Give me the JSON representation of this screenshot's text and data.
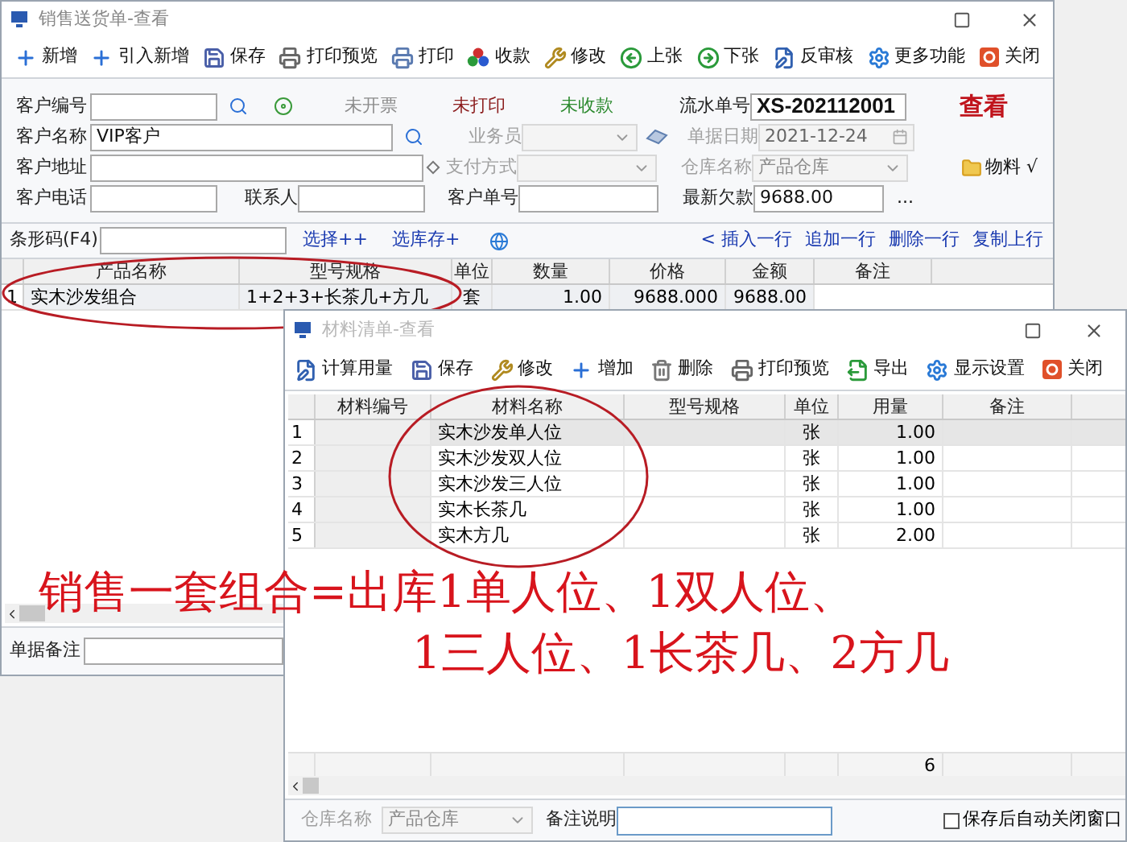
{
  "main_window": {
    "title": "销售送货单-查看",
    "toolbar": [
      {
        "label": "新增"
      },
      {
        "label": "引入新增"
      },
      {
        "label": "保存"
      },
      {
        "label": "打印预览"
      },
      {
        "label": "打印"
      },
      {
        "label": "收款"
      },
      {
        "label": "修改"
      },
      {
        "label": "上张"
      },
      {
        "label": "下张"
      },
      {
        "label": "反审核"
      },
      {
        "label": "更多功能"
      },
      {
        "label": "关闭"
      }
    ],
    "customer_code": {
      "label": "客户编号"
    },
    "status": [
      {
        "text": "未开票",
        "color": "#8c8c8c"
      },
      {
        "text": "未打印",
        "color": "#8b1c1c"
      },
      {
        "text": "未收款",
        "color": "#2e8b30"
      }
    ],
    "serial_no": {
      "label": "流水单号",
      "value": "XS-202112001"
    },
    "view_mode": "查看",
    "customer_name": {
      "label": "客户名称",
      "value": "VIP客户"
    },
    "salesperson": {
      "label": "业务员",
      "disabled": true
    },
    "doc_date": {
      "label": "单据日期",
      "value": "2021-12-24",
      "disabled": true
    },
    "customer_address": {
      "label": "客户地址"
    },
    "payment_method": {
      "label": "支付方式",
      "disabled": true
    },
    "warehouse": {
      "label": "仓库名称",
      "value": "产品仓库",
      "disabled": true
    },
    "materials_link": "物料 √",
    "customer_phone": {
      "label": "客户电话"
    },
    "contact": {
      "label": "联系人"
    },
    "customer_order_no": {
      "label": "客户单号"
    },
    "latest_debt": {
      "label": "最新欠款",
      "value": "9688.00"
    },
    "more_button": "...",
    "barcode": {
      "label": "条形码(F4)"
    },
    "links": [
      "选择++",
      "选库存+"
    ],
    "row_actions": [
      "< 插入一行",
      "追加一行",
      "删除一行",
      "复制上行"
    ],
    "table": {
      "columns": [
        "产品名称",
        "型号规格",
        "单位",
        "数量",
        "价格",
        "金额",
        "备注"
      ],
      "rows": [
        {
          "number": "1",
          "cells": [
            "实木沙发组合",
            "1+2+3+长茶几+方几",
            "套",
            "1.00",
            "9688.000",
            "9688.00"
          ]
        }
      ]
    },
    "remark": {
      "label": "单据备注"
    }
  },
  "material_window": {
    "title": "材料清单-查看",
    "toolbar": [
      {
        "label": "计算用量"
      },
      {
        "label": "保存"
      },
      {
        "label": "修改"
      },
      {
        "label": "增加"
      },
      {
        "label": "删除"
      },
      {
        "label": "打印预览"
      },
      {
        "label": "导出"
      },
      {
        "label": "显示设置"
      },
      {
        "label": "关闭"
      }
    ],
    "table": {
      "columns": [
        "材料编号",
        "材料名称",
        "型号规格",
        "单位",
        "用量",
        "备注"
      ],
      "rows": [
        {
          "number": "1",
          "selected": true,
          "cells": [
            "",
            "实木沙发单人位",
            "",
            "张",
            "1.00"
          ]
        },
        {
          "number": "2",
          "selected": false,
          "cells": [
            "",
            "实木沙发双人位",
            "",
            "张",
            "1.00"
          ]
        },
        {
          "number": "3",
          "selected": false,
          "cells": [
            "",
            "实木沙发三人位",
            "",
            "张",
            "1.00"
          ]
        },
        {
          "number": "4",
          "selected": false,
          "cells": [
            "",
            "实木长茶几",
            "",
            "张",
            "1.00"
          ]
        },
        {
          "number": "5",
          "selected": false,
          "cells": [
            "",
            "实木方几",
            "",
            "张",
            "2.00"
          ]
        }
      ],
      "quantity_total": "6"
    },
    "warehouse": {
      "label": "仓库名称",
      "value": "产品仓库",
      "disabled": true
    },
    "note": {
      "label": "备注说明"
    },
    "auto_close": {
      "label": "保存后自动关闭窗口",
      "checked": false
    }
  },
  "annotation": {
    "lines": [
      "销售一套组合=出库1单人位、1双人位、",
      "1三人位、1长茶几、2方几"
    ]
  }
}
